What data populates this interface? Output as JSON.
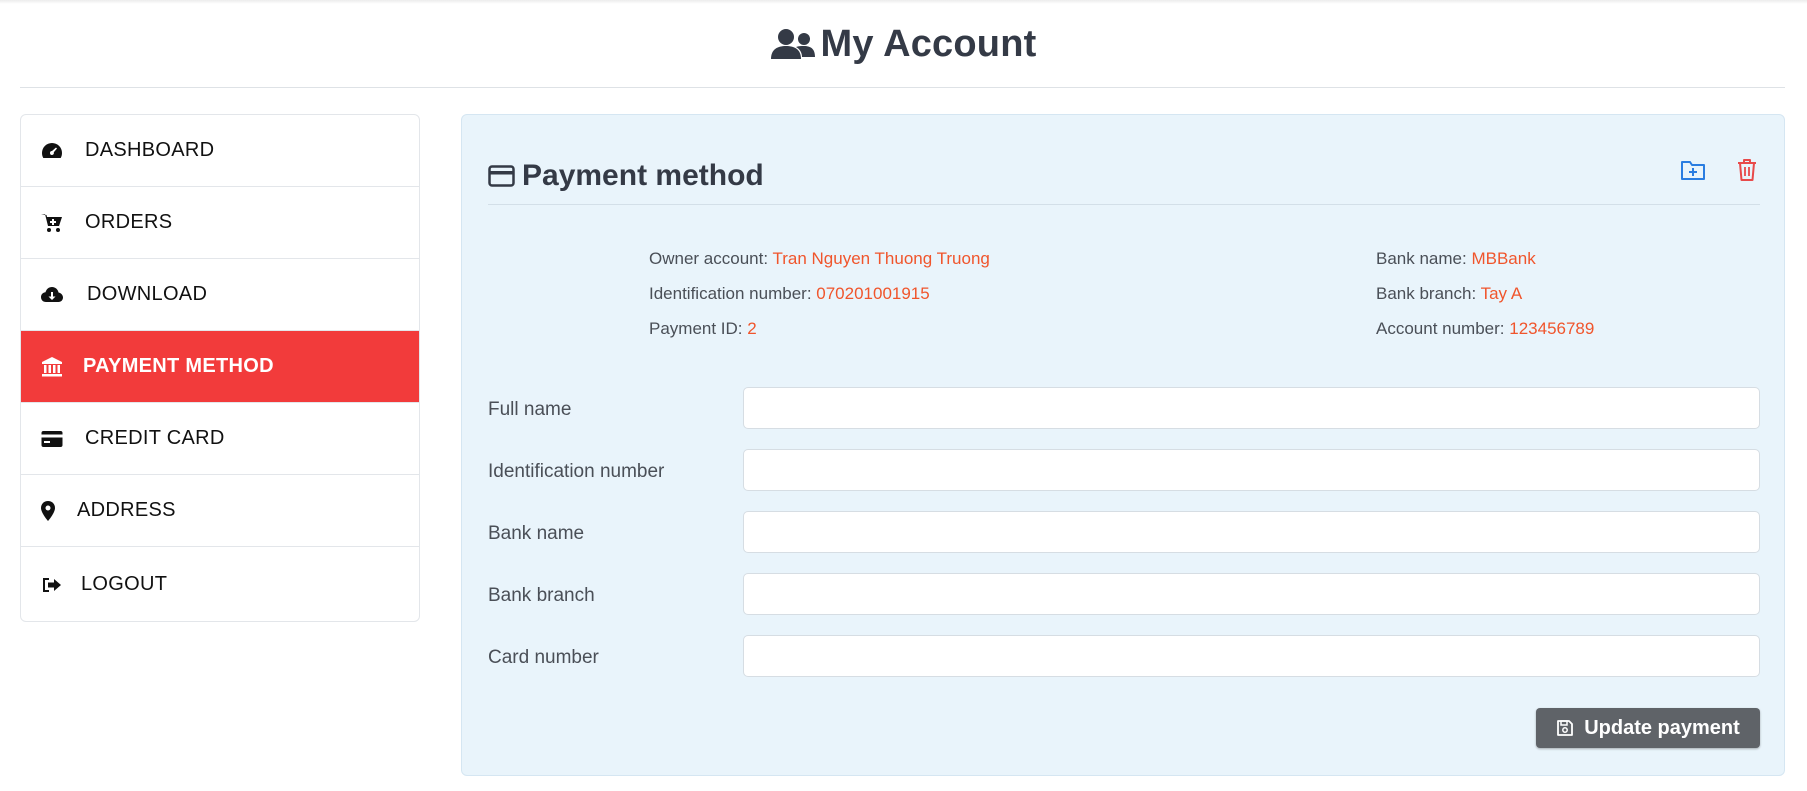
{
  "header": {
    "title": "My Account",
    "icon": "users-icon"
  },
  "sidebar": {
    "items": [
      {
        "label": "DASHBOARD",
        "icon": "dashboard-gauge-icon",
        "active": false
      },
      {
        "label": "ORDERS",
        "icon": "cart-icon",
        "active": false
      },
      {
        "label": "DOWNLOAD",
        "icon": "cloud-download-icon",
        "active": false
      },
      {
        "label": "PAYMENT METHOD",
        "icon": "bank-icon",
        "active": true
      },
      {
        "label": "CREDIT CARD",
        "icon": "credit-card-icon",
        "active": false
      },
      {
        "label": "ADDRESS",
        "icon": "map-marker-icon",
        "active": false
      },
      {
        "label": "LOGOUT",
        "icon": "sign-out-icon",
        "active": false
      }
    ],
    "active_color": "#f23b3b"
  },
  "panel": {
    "title": "Payment method",
    "title_icon": "credit-card-icon",
    "actions": {
      "add_icon": "folder-plus-icon",
      "delete_icon": "trash-icon"
    },
    "info_left": [
      {
        "label": "Owner account: ",
        "value": "Tran Nguyen Thuong Truong"
      },
      {
        "label": "Identification number: ",
        "value": "070201001915"
      },
      {
        "label": "Payment ID: ",
        "value": "2"
      }
    ],
    "info_right": [
      {
        "label": "Bank name: ",
        "value": "MBBank"
      },
      {
        "label": "Bank branch: ",
        "value": "Tay A"
      },
      {
        "label": "Account number: ",
        "value": "123456789"
      }
    ],
    "form": {
      "fields": [
        {
          "label": "Full name",
          "value": "",
          "placeholder": ""
        },
        {
          "label": "Identification number",
          "value": "",
          "placeholder": ""
        },
        {
          "label": "Bank name",
          "value": "",
          "placeholder": ""
        },
        {
          "label": "Bank branch",
          "value": "",
          "placeholder": ""
        },
        {
          "label": "Card number",
          "value": "",
          "placeholder": ""
        }
      ],
      "submit_label": "Update payment",
      "submit_icon": "save-icon"
    },
    "value_color": "#f0552c",
    "background_color": "#e9f4fb"
  }
}
